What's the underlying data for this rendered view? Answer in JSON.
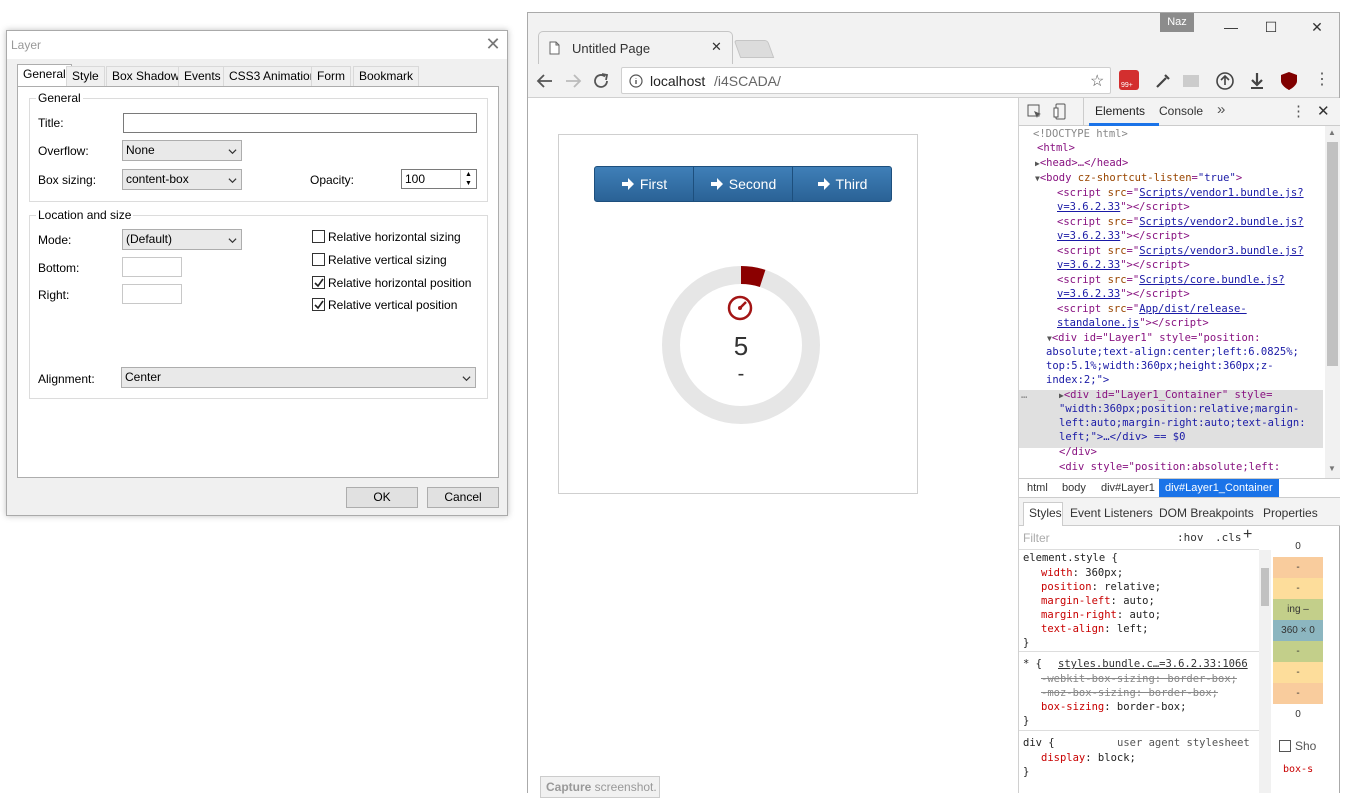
{
  "dialog": {
    "title": "Layer",
    "tabs": [
      "General",
      "Style",
      "Box Shadow",
      "Events",
      "CSS3 Animation",
      "Form",
      "Bookmark"
    ],
    "general_group": "General",
    "title_label": "Title:",
    "overflow_label": "Overflow:",
    "overflow_value": "None",
    "box_sizing_label": "Box sizing:",
    "box_sizing_value": "content-box",
    "opacity_label": "Opacity:",
    "opacity_value": "100",
    "location_group": "Location and size",
    "mode_label": "Mode:",
    "mode_value": "(Default)",
    "bottom_label": "Bottom:",
    "right_label": "Right:",
    "checkboxes": [
      {
        "label": "Relative horizontal sizing",
        "checked": false
      },
      {
        "label": "Relative vertical sizing",
        "checked": false
      },
      {
        "label": "Relative horizontal position",
        "checked": true
      },
      {
        "label": "Relative vertical position",
        "checked": true
      }
    ],
    "alignment_label": "Alignment:",
    "alignment_value": "Center",
    "ok": "OK",
    "cancel": "Cancel"
  },
  "browser": {
    "tab_title": "Untitled Page",
    "profile": "Naz",
    "url_host": "localhost",
    "url_path": "/i4SCADA/",
    "ext_badge": "99+"
  },
  "page": {
    "buttons": [
      "First",
      "Second",
      "Third"
    ],
    "gauge_value": "5",
    "gauge_unit": "-",
    "gauge_fraction": 0.05,
    "brand_color": "#2a6296",
    "gauge_color": "#8b0000"
  },
  "devtools": {
    "tabs": [
      "Elements",
      "Console"
    ],
    "dom": {
      "doctype": "<!DOCTYPE html>",
      "html_open": "<html>",
      "head": "<head>…</head>",
      "body_open": "<body",
      "body_attr": " cz-shortcut-listen",
      "body_val": "\"true\"",
      "scripts": [
        {
          "src1": "Scripts/vendor1.bundle.js?",
          "src2": "v=3.6.2.33"
        },
        {
          "src1": "Scripts/vendor2.bundle.js?",
          "src2": "v=3.6.2.33"
        },
        {
          "src1": "Scripts/vendor3.bundle.js?",
          "src2": "v=3.6.2.33"
        },
        {
          "src1": "Scripts/core.bundle.js?",
          "src2": "v=3.6.2.33"
        },
        {
          "src1": "App/dist/release-",
          "src2": "standalone.js"
        }
      ],
      "layer1_a": "<div id=\"Layer1\" style=\"position:",
      "layer1_b": "absolute;text-align:center;left:6.0825%;",
      "layer1_c": "top:5.1%;width:360px;height:360px;z-",
      "layer1_d": "index:2;\">",
      "sel_a": "<div id=\"Layer1_Container\" style=",
      "sel_b": "\"width:360px;position:relative;margin-",
      "sel_c": "left:auto;margin-right:auto;text-align:",
      "sel_d": "left;\">…</div> == $0",
      "close_div": "</div>",
      "last_div": "<div style=\"position:absolute;left:"
    },
    "breadcrumb": [
      "html",
      "body",
      "div#Layer1",
      "div#Layer1_Container"
    ],
    "styles_tabs": [
      "Styles",
      "Event Listeners",
      "DOM Breakpoints",
      "Properties"
    ],
    "filter_placeholder": "Filter",
    "hov": ":hov",
    "cls": ".cls",
    "element_style_selector": "element.style {",
    "element_style_props": [
      {
        "name": "width",
        "value": "360px;"
      },
      {
        "name": "position",
        "value": "relative;"
      },
      {
        "name": "margin-left",
        "value": "auto;"
      },
      {
        "name": "margin-right",
        "value": "auto;"
      },
      {
        "name": "text-align",
        "value": "left;"
      }
    ],
    "universal_selector": "* {",
    "universal_source": "styles.bundle.c…=3.6.2.33:1066",
    "universal_props": [
      {
        "text": "-webkit-box-sizing: border-box;",
        "struck": true
      },
      {
        "text": "-moz-box-sizing: border-box;",
        "struck": true
      },
      {
        "name": "box-sizing",
        "value": "border-box;",
        "struck": false
      }
    ],
    "div_selector": "div {",
    "ua_label": "user agent stylesheet",
    "div_prop": {
      "name": "display",
      "value": "block;"
    },
    "boxmodel": [
      "0",
      "-",
      "-",
      "ing –",
      "360 × 0",
      "-",
      "-",
      "-",
      "0"
    ],
    "show_all": "Sho",
    "box_s": "box-s"
  },
  "capture": {
    "bold": "Capture",
    "rest": " screenshot."
  }
}
